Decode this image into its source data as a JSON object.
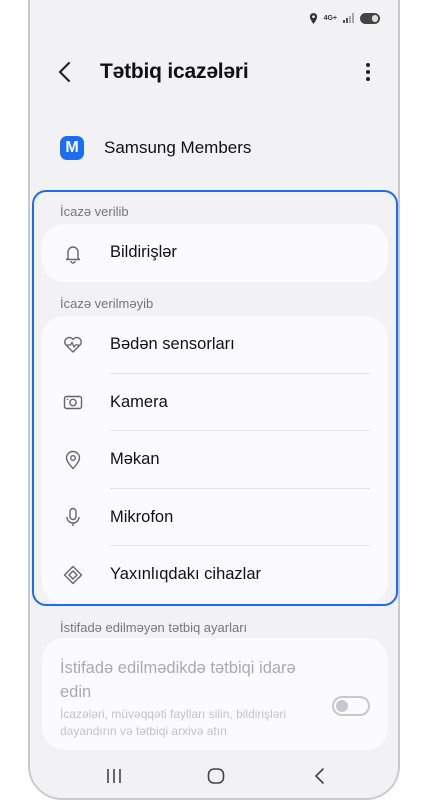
{
  "header": {
    "title": "Tətbiq icazələri"
  },
  "app": {
    "icon_letter": "M",
    "name": "Samsung Members",
    "icon_color": "#1c6ef0"
  },
  "allowed": {
    "label": "İcazə verilib",
    "items": [
      {
        "label": "Bildirişlər",
        "icon": "bell-icon"
      }
    ]
  },
  "denied": {
    "label": "İcazə verilməyib",
    "items": [
      {
        "label": "Bədən sensorları",
        "icon": "heart-pulse-icon"
      },
      {
        "label": "Kamera",
        "icon": "camera-icon"
      },
      {
        "label": "Məkan",
        "icon": "location-pin-icon"
      },
      {
        "label": "Mikrofon",
        "icon": "microphone-icon"
      },
      {
        "label": "Yaxınlıqdakı cihazlar",
        "icon": "nearby-devices-icon"
      }
    ]
  },
  "unused": {
    "label": "İstifadə edilməyən tətbiq ayarları",
    "title": "İstifadə edilmədikdə tətbiqi idarə edin",
    "description": "İcazələri, müvəqqəti faylları silin, bildirişləri dayandırın və tətbiqi arxivə atın",
    "toggle_on": false
  },
  "status_bar": {
    "network": "4G+"
  },
  "colors": {
    "highlight": "#1a6ef5"
  }
}
